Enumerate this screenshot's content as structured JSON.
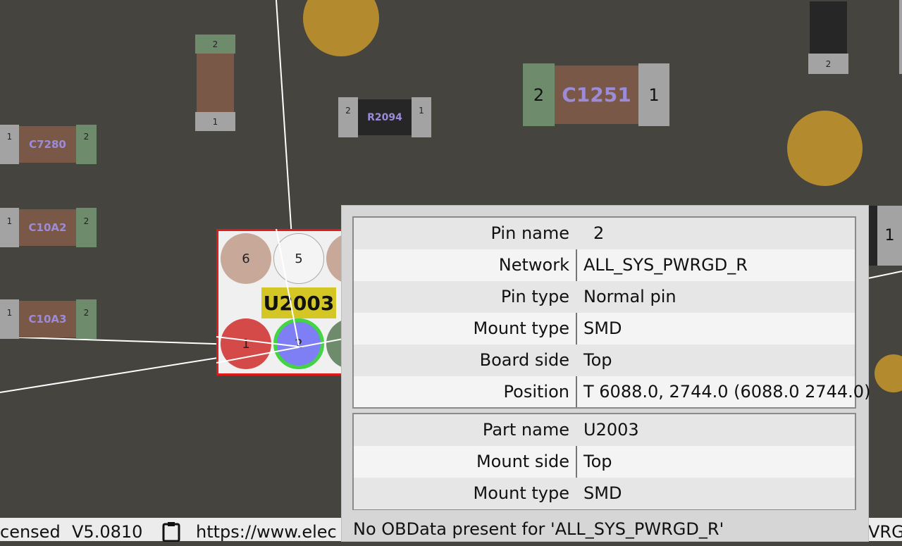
{
  "board": {
    "components": {
      "c7280": {
        "name": "C7280",
        "pin_left": "1",
        "pin_right": "2"
      },
      "c10a2": {
        "name": "C10A2",
        "pin_left": "1",
        "pin_right": "2"
      },
      "c10a3": {
        "name": "C10A3",
        "pin_left": "1",
        "pin_right": "2"
      },
      "r2094": {
        "name": "R2094",
        "pin_left": "2",
        "pin_right": "1"
      },
      "c1251": {
        "name": "C1251",
        "pin_left": "2",
        "pin_right": "1"
      },
      "vert_top": {
        "pin_top": "2",
        "pin_bottom": "1"
      },
      "top_right": {
        "pin_bottom": "2"
      },
      "right_edge": {
        "pin": "1"
      },
      "u2003": {
        "name": "U2003",
        "pins": [
          "6",
          "5",
          "1",
          "2"
        ]
      }
    },
    "colors": {
      "background": "#46443f",
      "pad_green": "#6e8b6b",
      "pad_gray": "#a3a3a3",
      "body_brown": "#7a5848",
      "via_gold": "#b38a2e",
      "selection_red": "#e0191b",
      "highlight_green": "#43d442",
      "pin_blue": "#7f7ff5"
    }
  },
  "popup": {
    "pin_table": [
      {
        "key": "Pin name",
        "value": "2"
      },
      {
        "key": "Network",
        "value": "ALL_SYS_PWRGD_R"
      },
      {
        "key": "Pin type",
        "value": "Normal pin"
      },
      {
        "key": "Mount type",
        "value": "SMD"
      },
      {
        "key": "Board side",
        "value": "Top"
      },
      {
        "key": "Position",
        "value": "T 6088.0, 2744.0 (6088.0 2744.0)"
      }
    ],
    "part_table": [
      {
        "key": "Part name",
        "value": "U2003"
      },
      {
        "key": "Mount side",
        "value": "Top"
      },
      {
        "key": "Mount type",
        "value": "SMD"
      }
    ],
    "footer": "No OBData present for 'ALL_SYS_PWRGD_R'"
  },
  "statusbar": {
    "license": "censed",
    "version": "V5.0810",
    "clipboard_icon": "clipboard-icon",
    "url": "https://www.elec",
    "right_text": "VRGI"
  }
}
